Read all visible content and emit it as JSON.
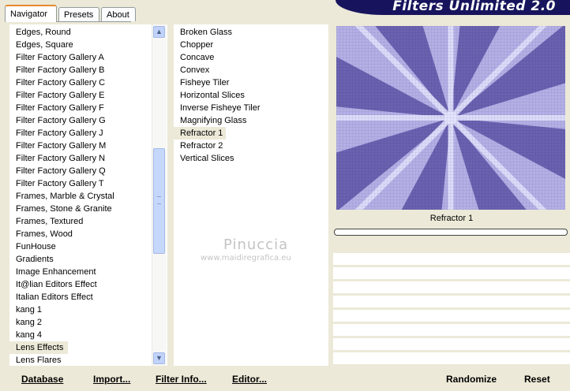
{
  "app": {
    "title": "Filters Unlimited 2.0"
  },
  "tabs": [
    {
      "label": "Navigator",
      "active": true
    },
    {
      "label": "Presets",
      "active": false
    },
    {
      "label": "About",
      "active": false
    }
  ],
  "categories": {
    "items": [
      "Edges, Round",
      "Edges, Square",
      "Filter Factory Gallery A",
      "Filter Factory Gallery B",
      "Filter Factory Gallery C",
      "Filter Factory Gallery E",
      "Filter Factory Gallery F",
      "Filter Factory Gallery G",
      "Filter Factory Gallery J",
      "Filter Factory Gallery M",
      "Filter Factory Gallery N",
      "Filter Factory Gallery Q",
      "Filter Factory Gallery T",
      "Frames, Marble & Crystal",
      "Frames, Stone & Granite",
      "Frames, Textured",
      "Frames, Wood",
      "FunHouse",
      "Gradients",
      "Image Enhancement",
      "It@lian Editors Effect",
      "Italian Editors Effect",
      "kang 1",
      "kang 2",
      "kang 4",
      "Lens Effects",
      "Lens Flares"
    ],
    "selected": "Lens Effects"
  },
  "filters": {
    "items": [
      "Broken Glass",
      "Chopper",
      "Concave",
      "Convex",
      "Fisheye Tiler",
      "Horizontal Slices",
      "Inverse Fisheye Tiler",
      "Magnifying Glass",
      "Refractor 1",
      "Refractor 2",
      "Vertical Slices"
    ],
    "selected": "Refractor 1"
  },
  "watermark": {
    "line1": "Pinuccia",
    "line2": "www.maidiregrafica.eu"
  },
  "preview": {
    "filter_name": "Refractor 1",
    "colors": {
      "light": "#e4e4ff",
      "dark": "#4f4593",
      "mid": "#8c86d4"
    }
  },
  "buttons": {
    "database": "Database",
    "import": "Import...",
    "filter_info": "Filter Info...",
    "editor": "Editor...",
    "randomize": "Randomize",
    "reset": "Reset"
  },
  "icons": {
    "scroll_up": "chevron-up-icon",
    "scroll_down": "chevron-down-icon"
  }
}
